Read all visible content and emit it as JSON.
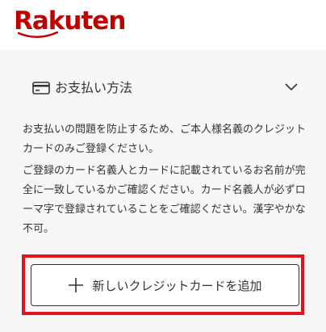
{
  "header": {
    "logo_text": "Rakuten",
    "brand_color": "#bf0000"
  },
  "payment": {
    "section_title": "お支払い方法",
    "section_icon": "credit-card-icon",
    "toggle_icon": "chevron-down-icon",
    "description_1": "お支払いの問題を防止するため、ご本人様名義のクレジットカードのみご登録ください。",
    "description_2": "ご登録のカード名義人とカードに記載されているお名前が完全に一致しているかご確認ください。カード名義人が必ずローマ字で登録されていることをご確認ください。漢字やかな不可。",
    "add_card_label": "新しいクレジットカードを追加",
    "add_card_icon": "plus-icon",
    "highlight_color": "#e0141e"
  }
}
